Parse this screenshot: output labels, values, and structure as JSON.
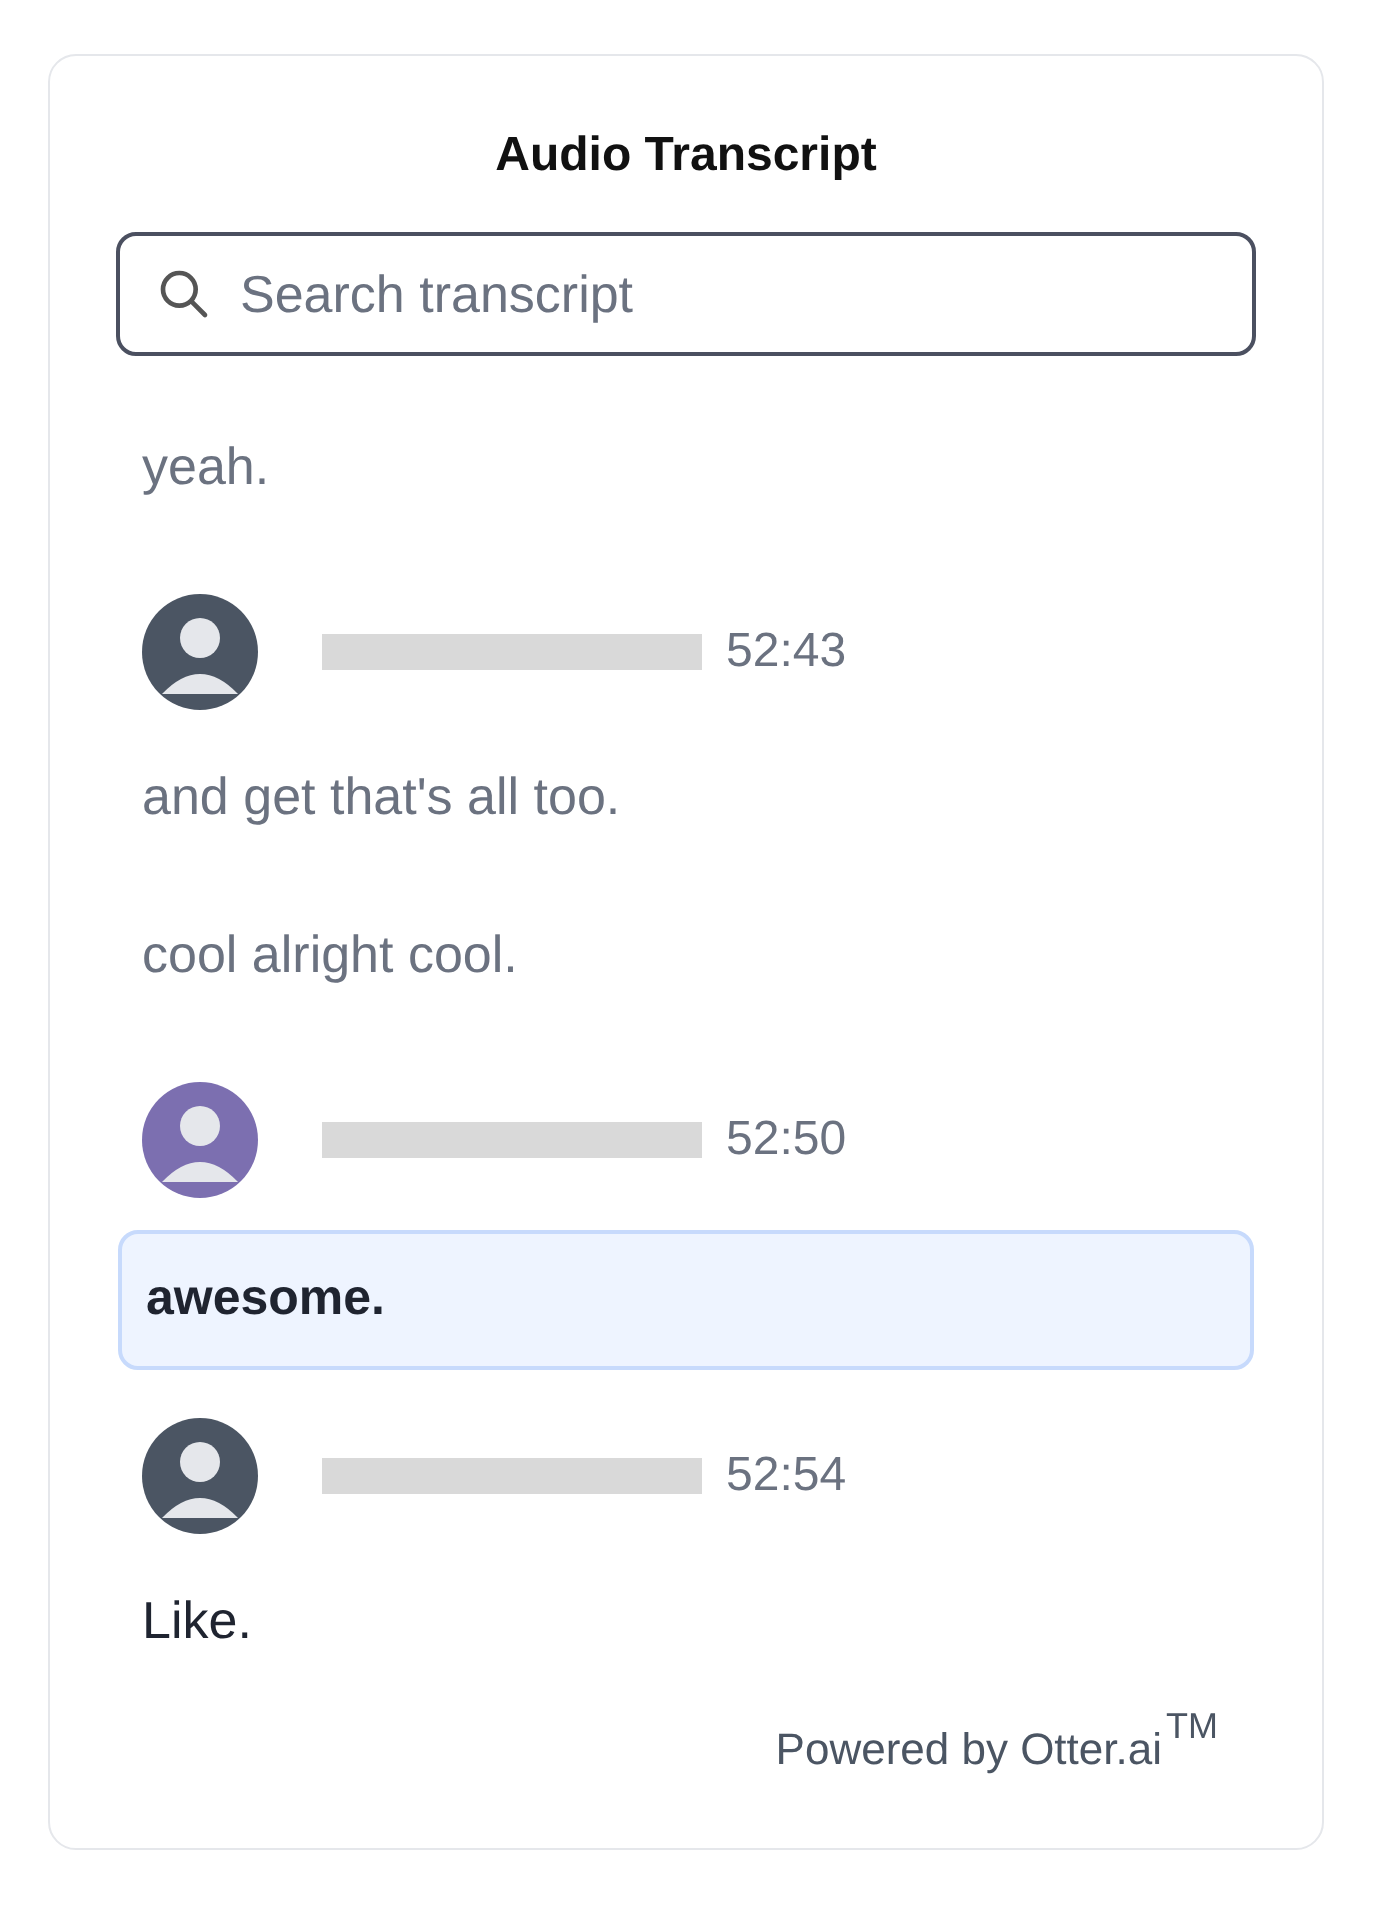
{
  "title": "Audio Transcript",
  "search": {
    "placeholder": "Search transcript"
  },
  "entries": [
    {
      "kind": "line",
      "text": "yeah.",
      "played": true,
      "current": false
    },
    {
      "kind": "speaker",
      "time": "52:43",
      "color": "#4b5563"
    },
    {
      "kind": "line",
      "text": "and get that's all too.",
      "played": true,
      "current": false
    },
    {
      "kind": "line",
      "text": "cool alright cool.",
      "played": true,
      "current": false
    },
    {
      "kind": "speaker",
      "time": "52:50",
      "color": "#7c6fb0"
    },
    {
      "kind": "line",
      "text": "awesome.",
      "played": false,
      "current": true
    },
    {
      "kind": "speaker",
      "time": "52:54",
      "color": "#4b5563"
    },
    {
      "kind": "line",
      "text": "Like.",
      "played": false,
      "current": false
    }
  ],
  "footer": {
    "text": "Powered by Otter.ai",
    "mark": "TM"
  }
}
